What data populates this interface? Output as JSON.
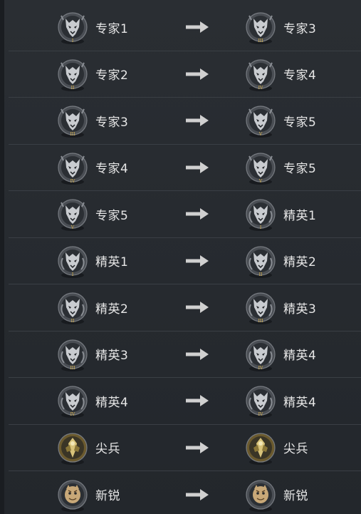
{
  "rows": [
    {
      "from": {
        "label": "专家1",
        "badge": "expert-wolf-badge",
        "numeral": "I"
      },
      "to": {
        "label": "专家3",
        "badge": "expert-wolf-badge",
        "numeral": "III"
      }
    },
    {
      "from": {
        "label": "专家2",
        "badge": "expert-wolf-badge",
        "numeral": "II"
      },
      "to": {
        "label": "专家4",
        "badge": "expert-wolf-badge",
        "numeral": "IV"
      }
    },
    {
      "from": {
        "label": "专家3",
        "badge": "expert-wolf-badge",
        "numeral": "III"
      },
      "to": {
        "label": "专家5",
        "badge": "expert-wolf-badge",
        "numeral": "V"
      }
    },
    {
      "from": {
        "label": "专家4",
        "badge": "expert-wolf-badge",
        "numeral": "IV"
      },
      "to": {
        "label": "专家5",
        "badge": "expert-wolf-badge",
        "numeral": "V"
      }
    },
    {
      "from": {
        "label": "专家5",
        "badge": "expert-wolf-badge",
        "numeral": "V"
      },
      "to": {
        "label": "精英1",
        "badge": "elite-wolf-badge",
        "numeral": "I"
      }
    },
    {
      "from": {
        "label": "精英1",
        "badge": "elite-wolf-badge",
        "numeral": "I"
      },
      "to": {
        "label": "精英2",
        "badge": "elite-wolf-badge",
        "numeral": "II"
      }
    },
    {
      "from": {
        "label": "精英2",
        "badge": "elite-wolf-badge",
        "numeral": "II"
      },
      "to": {
        "label": "精英3",
        "badge": "elite-wolf-badge",
        "numeral": "III"
      }
    },
    {
      "from": {
        "label": "精英3",
        "badge": "elite-wolf-badge",
        "numeral": "III"
      },
      "to": {
        "label": "精英4",
        "badge": "elite-wolf-badge",
        "numeral": "IV"
      }
    },
    {
      "from": {
        "label": "精英4",
        "badge": "elite-wolf-badge",
        "numeral": "IV"
      },
      "to": {
        "label": "精英4",
        "badge": "elite-wolf-badge",
        "numeral": "IV"
      }
    },
    {
      "from": {
        "label": "尖兵",
        "badge": "vanguard-eagle-badge",
        "numeral": ""
      },
      "to": {
        "label": "尖兵",
        "badge": "vanguard-eagle-badge",
        "numeral": ""
      }
    },
    {
      "from": {
        "label": "新锐",
        "badge": "rookie-tiger-badge",
        "numeral": ""
      },
      "to": {
        "label": "新锐",
        "badge": "rookie-tiger-badge",
        "numeral": ""
      }
    }
  ],
  "arrow_icon": "right-arrow-icon",
  "colors": {
    "background": "#24282d",
    "row_divider": "#3a3f45",
    "label_text": "#e6e6e6",
    "arrow": "#d0d0d0",
    "badge_silver": "#b9bcc0",
    "badge_gold": "#c9a85a"
  }
}
